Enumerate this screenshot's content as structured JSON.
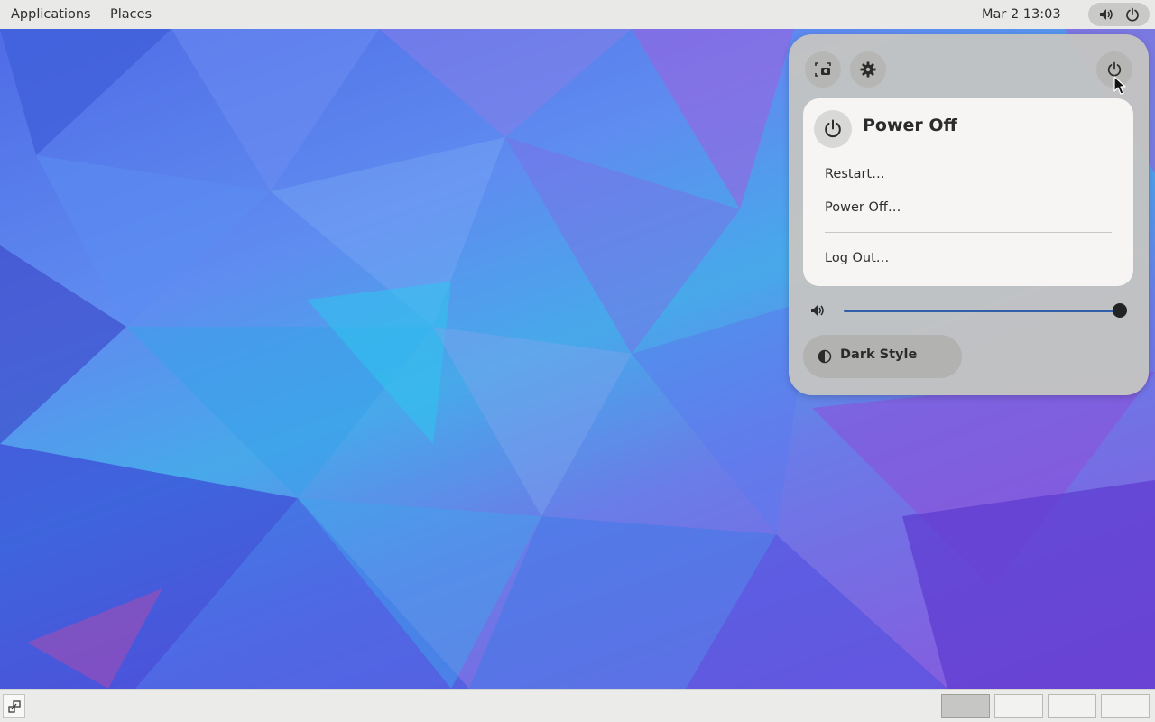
{
  "topbar": {
    "applications_label": "Applications",
    "places_label": "Places",
    "clock": "Mar 2  13:03",
    "status_icons": [
      "volume-icon",
      "power-icon"
    ]
  },
  "quick_settings": {
    "buttons": [
      "screenshot-icon",
      "gear-icon",
      "power-icon"
    ],
    "power_menu": {
      "title": "Power Off",
      "items": [
        "Restart…",
        "Power Off…",
        "Log Out…"
      ]
    },
    "volume": {
      "icon": "volume-icon",
      "level": 1.0
    },
    "dark_style": {
      "label": "Dark Style",
      "icon": "dark-style-icon",
      "enabled": false
    }
  },
  "bottombar": {
    "show_desktop_icon": "show-desktop-icon",
    "workspaces": {
      "count": 4,
      "active_index": 0
    }
  },
  "colors": {
    "accent": "#2f5fa8",
    "panel": "#c4c4c2",
    "menu": "#f6f5f4",
    "topbar": "#e9e9e7"
  }
}
